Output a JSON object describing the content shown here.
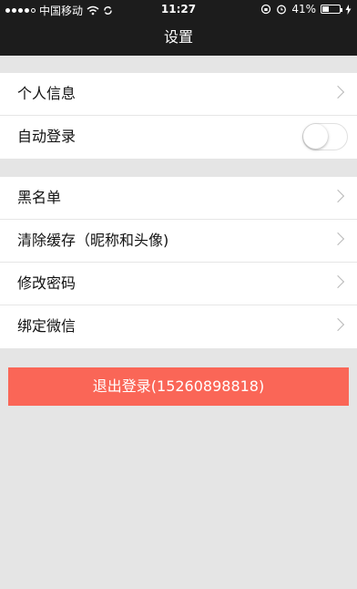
{
  "status_bar": {
    "carrier": "中国移动",
    "time": "11:27",
    "battery": "41%",
    "battery_level": 0.41
  },
  "navbar": {
    "title": "设置"
  },
  "group1": [
    {
      "label": "个人信息"
    },
    {
      "label": "自动登录",
      "toggle_on": false
    }
  ],
  "group2": [
    {
      "label": "黑名单"
    },
    {
      "label": "清除缓存（昵称和头像)"
    },
    {
      "label": "修改密码"
    },
    {
      "label": "绑定微信"
    }
  ],
  "logout": {
    "label": "退出登录(15260898818)",
    "color": "#fa6657"
  },
  "colors": {
    "bar_bg": "#1c1c1c",
    "page_bg": "#e5e5e5"
  }
}
